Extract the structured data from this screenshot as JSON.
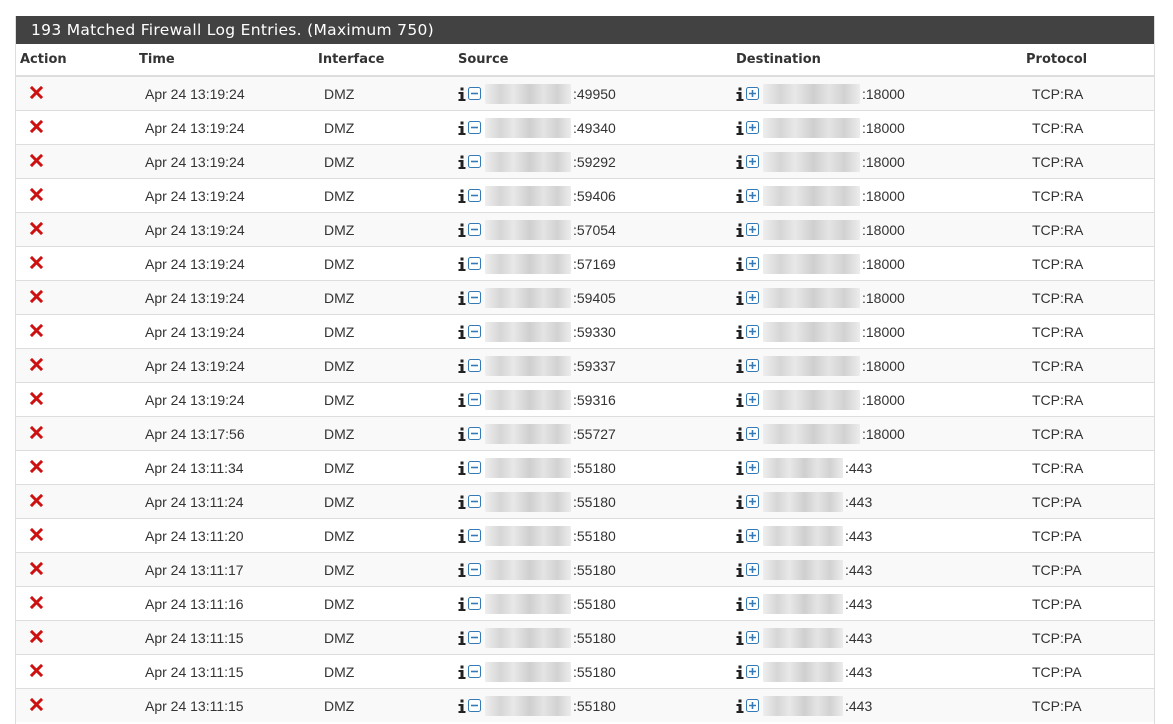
{
  "panel": {
    "title": "193 Matched Firewall Log Entries. (Maximum 750)"
  },
  "columns": {
    "action": "Action",
    "time": "Time",
    "interface": "Interface",
    "source": "Source",
    "destination": "Destination",
    "protocol": "Protocol"
  },
  "icons": {
    "action": "block-x-icon",
    "info": "info-icon",
    "source_rule": "minus-square-icon",
    "destination_rule": "plus-square-icon"
  },
  "colors": {
    "heading_bg": "#424242",
    "block_red": "#cc1111",
    "icon_blue": "#337ab7"
  },
  "rows": [
    {
      "time": "Apr 24 13:19:24",
      "interface": "DMZ",
      "source_port": ":49950",
      "destination_port": ":18000",
      "protocol": "TCP:RA"
    },
    {
      "time": "Apr 24 13:19:24",
      "interface": "DMZ",
      "source_port": ":49340",
      "destination_port": ":18000",
      "protocol": "TCP:RA"
    },
    {
      "time": "Apr 24 13:19:24",
      "interface": "DMZ",
      "source_port": ":59292",
      "destination_port": ":18000",
      "protocol": "TCP:RA"
    },
    {
      "time": "Apr 24 13:19:24",
      "interface": "DMZ",
      "source_port": ":59406",
      "destination_port": ":18000",
      "protocol": "TCP:RA"
    },
    {
      "time": "Apr 24 13:19:24",
      "interface": "DMZ",
      "source_port": ":57054",
      "destination_port": ":18000",
      "protocol": "TCP:RA"
    },
    {
      "time": "Apr 24 13:19:24",
      "interface": "DMZ",
      "source_port": ":57169",
      "destination_port": ":18000",
      "protocol": "TCP:RA"
    },
    {
      "time": "Apr 24 13:19:24",
      "interface": "DMZ",
      "source_port": ":59405",
      "destination_port": ":18000",
      "protocol": "TCP:RA"
    },
    {
      "time": "Apr 24 13:19:24",
      "interface": "DMZ",
      "source_port": ":59330",
      "destination_port": ":18000",
      "protocol": "TCP:RA"
    },
    {
      "time": "Apr 24 13:19:24",
      "interface": "DMZ",
      "source_port": ":59337",
      "destination_port": ":18000",
      "protocol": "TCP:RA"
    },
    {
      "time": "Apr 24 13:19:24",
      "interface": "DMZ",
      "source_port": ":59316",
      "destination_port": ":18000",
      "protocol": "TCP:RA"
    },
    {
      "time": "Apr 24 13:17:56",
      "interface": "DMZ",
      "source_port": ":55727",
      "destination_port": ":18000",
      "protocol": "TCP:RA"
    },
    {
      "time": "Apr 24 13:11:34",
      "interface": "DMZ",
      "source_port": ":55180",
      "destination_port": ":443",
      "protocol": "TCP:RA"
    },
    {
      "time": "Apr 24 13:11:24",
      "interface": "DMZ",
      "source_port": ":55180",
      "destination_port": ":443",
      "protocol": "TCP:PA"
    },
    {
      "time": "Apr 24 13:11:20",
      "interface": "DMZ",
      "source_port": ":55180",
      "destination_port": ":443",
      "protocol": "TCP:PA"
    },
    {
      "time": "Apr 24 13:11:17",
      "interface": "DMZ",
      "source_port": ":55180",
      "destination_port": ":443",
      "protocol": "TCP:PA"
    },
    {
      "time": "Apr 24 13:11:16",
      "interface": "DMZ",
      "source_port": ":55180",
      "destination_port": ":443",
      "protocol": "TCP:PA"
    },
    {
      "time": "Apr 24 13:11:15",
      "interface": "DMZ",
      "source_port": ":55180",
      "destination_port": ":443",
      "protocol": "TCP:PA"
    },
    {
      "time": "Apr 24 13:11:15",
      "interface": "DMZ",
      "source_port": ":55180",
      "destination_port": ":443",
      "protocol": "TCP:PA"
    },
    {
      "time": "Apr 24 13:11:15",
      "interface": "DMZ",
      "source_port": ":55180",
      "destination_port": ":443",
      "protocol": "TCP:PA"
    }
  ]
}
